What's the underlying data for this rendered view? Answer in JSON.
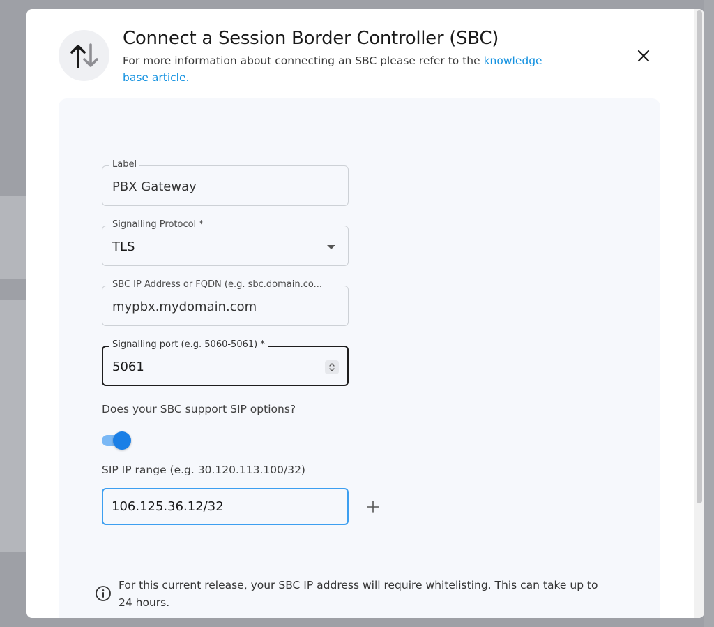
{
  "modal": {
    "title": "Connect a Session Border Controller (SBC)",
    "subtitle_prefix": "For more information about connecting an SBC please refer to the ",
    "subtitle_link": "knowledge base article.",
    "header_icon": "arrow-up-down-icon",
    "close_icon": "close-icon"
  },
  "form": {
    "label_field": {
      "label": "Label",
      "value": "PBX Gateway"
    },
    "protocol_field": {
      "label": "Signalling Protocol *",
      "value": "TLS"
    },
    "sbc_field": {
      "label": "SBC IP Address or FQDN (e.g. sbc.domain.co...",
      "value": "mypbx.mydomain.com"
    },
    "port_field": {
      "label": "Signalling port (e.g. 5060-5061) *",
      "value": "5061"
    },
    "sip_options_question": "Does your SBC support SIP options?",
    "sip_options_enabled": true,
    "sip_range_label": "SIP IP range (e.g. 30.120.113.100/32)",
    "sip_range_value": "106.125.36.12/32",
    "info_text": "For this current release, your SBC IP address will require whitelisting. This can take up to 24 hours."
  },
  "colors": {
    "accent": "#1a7fe6",
    "link": "#1391e0",
    "panel_bg": "#f6f8fc",
    "overlay": "#9ea0a6"
  }
}
